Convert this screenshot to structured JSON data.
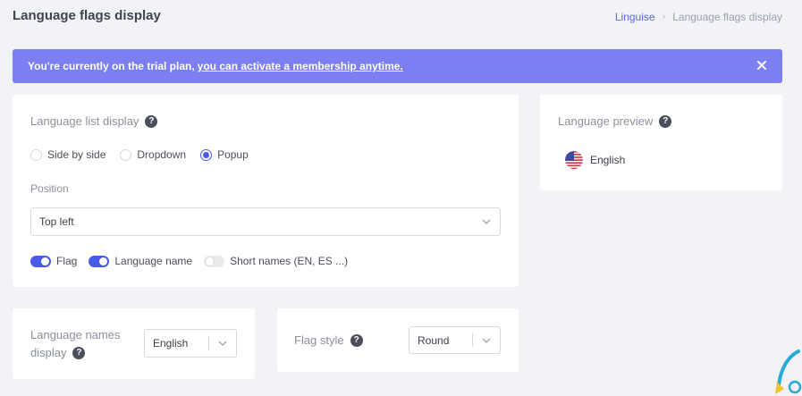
{
  "header": {
    "title": "Language flags display",
    "breadcrumb": {
      "root": "Linguise",
      "current": "Language flags display"
    }
  },
  "banner": {
    "text": "You're currently on the trial plan,",
    "link": "you can activate a membership anytime."
  },
  "list_display": {
    "title": "Language list display",
    "options": [
      "Side by side",
      "Dropdown",
      "Popup"
    ],
    "selected": "Popup",
    "position_label": "Position",
    "position_value": "Top left",
    "toggles": [
      {
        "label": "Flag",
        "on": true
      },
      {
        "label": "Language name",
        "on": true
      },
      {
        "label": "Short names (EN, ES ...)",
        "on": false
      }
    ]
  },
  "preview": {
    "title": "Language preview",
    "language": "English",
    "flag_icon": "us-flag-icon"
  },
  "names_display": {
    "title_line1": "Language names",
    "title_line2": "display",
    "value": "English"
  },
  "flag_style": {
    "title": "Flag style",
    "value": "Round"
  },
  "colors": {
    "accent": "#4a5ae8",
    "banner": "#7b7ff2",
    "background": "#f1f3f7"
  }
}
